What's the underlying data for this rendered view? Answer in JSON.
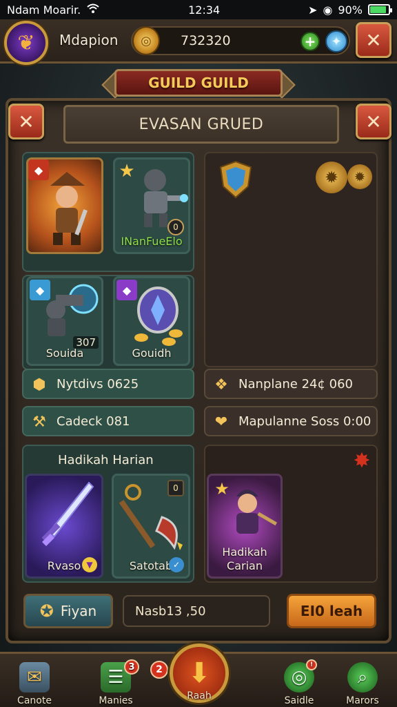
{
  "status_bar": {
    "carrier": "Ndam Moarir.",
    "time": "12:34",
    "battery": "90%"
  },
  "top_bar": {
    "player_name": "Mdapion",
    "gold": "732320"
  },
  "banner": {
    "guild_title": "GUILD GUILD",
    "panel_title": "EVASAN GRUED"
  },
  "heroes": [
    {
      "name": "",
      "number": ""
    },
    {
      "name": "INanFueElo",
      "number": ""
    },
    {
      "name": "Souida",
      "number": "307"
    },
    {
      "name": "Gouidh",
      "number": ""
    }
  ],
  "stats": [
    {
      "label": "Nytdivs 0625"
    },
    {
      "label": "Cadeck 081"
    },
    {
      "label": "Nanplane 24¢ 060"
    },
    {
      "label": "Mapulanne Soss 0:00"
    }
  ],
  "section": {
    "title": "Hadikah Harian",
    "items": [
      {
        "name": "Rvaso"
      },
      {
        "name": "Satotab"
      }
    ],
    "featured": {
      "line1": "Hadikah",
      "line2": "Carian"
    }
  },
  "actions": {
    "left_button": "Fiyan",
    "input_value": "Nasb13 ,50",
    "right_button": "EI0 leah"
  },
  "nav": {
    "items": [
      {
        "label": "Canote",
        "badge": ""
      },
      {
        "label": "Manies",
        "badge": "3"
      },
      {
        "label": "",
        "badge": "2"
      },
      {
        "label": "Raah",
        "badge": ""
      },
      {
        "label": "Saidle",
        "badge": ""
      },
      {
        "label": "Marors",
        "badge": ""
      }
    ]
  },
  "colors": {
    "accent_gold": "#c99a3c",
    "danger_red": "#9a2a1a",
    "teal_panel": "#253a35",
    "orange_button": "#f5a43a"
  }
}
